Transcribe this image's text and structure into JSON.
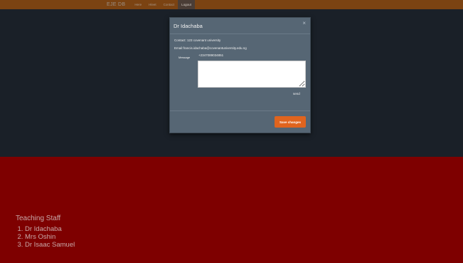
{
  "navbar": {
    "brand": "EJE DB",
    "links": [
      "Here",
      "Hleet",
      "Contact",
      "Logout"
    ]
  },
  "staff": {
    "title": "Teaching Staff",
    "members": [
      "Dr Idachaba",
      "Mrs Oshin",
      "Dr Isaac Samuel"
    ]
  },
  "modal": {
    "title": "Dr Idachaba",
    "close_glyph": "×",
    "contact": "Contact: 123 covenant university",
    "email": "Email:francis.idachaba@covenantuniversity.edu.ng",
    "message_label": "Message",
    "phone": "+2347089034851",
    "message_value": "",
    "send_label": "send",
    "save_label": "Save changes"
  },
  "colors": {
    "navbar": "#7b4312",
    "top_panel": "#1a2028",
    "page_background": "#7e0000",
    "modal_background": "#566674",
    "save_button": "#e0641e"
  }
}
